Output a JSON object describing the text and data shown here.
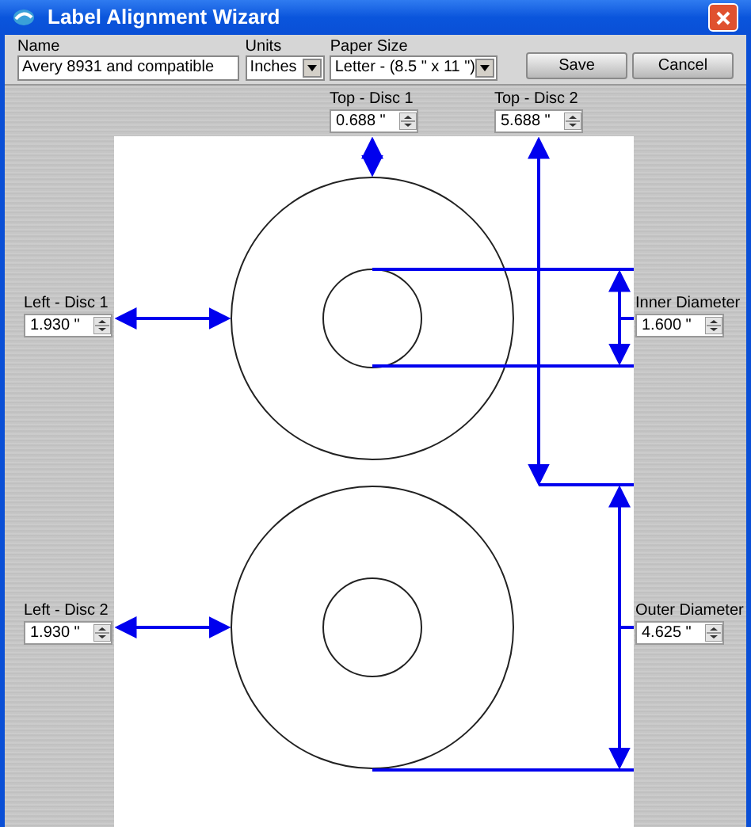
{
  "window": {
    "title": "Label Alignment Wizard"
  },
  "toolbar": {
    "name": {
      "label": "Name",
      "value": "Avery 8931 and compatible"
    },
    "units": {
      "label": "Units",
      "value": "Inches"
    },
    "paper_size": {
      "label": "Paper Size",
      "value": "Letter - (8.5 \" x 11 \")"
    },
    "buttons": [
      "Save",
      "Cancel"
    ]
  },
  "spin_fields": [
    {
      "kind": "top1",
      "label": "Top - Disc 1",
      "value": "0.688 \""
    },
    {
      "kind": "top2",
      "label": "Top - Disc 2",
      "value": "5.688 \""
    },
    {
      "kind": "left1",
      "label": "Left - Disc 1",
      "value": "1.930 \""
    },
    {
      "kind": "inner",
      "label": "Inner Diameter",
      "value": "1.600 \""
    },
    {
      "kind": "left2",
      "label": "Left - Disc 2",
      "value": "1.930 \""
    },
    {
      "kind": "outer",
      "label": "Outer Diameter",
      "value": "4.625 \""
    }
  ]
}
